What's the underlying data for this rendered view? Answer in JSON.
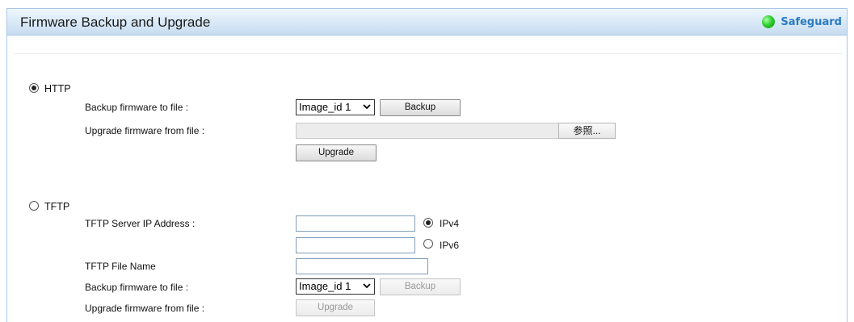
{
  "header": {
    "title": "Firmware Backup and Upgrade",
    "safeguard_label": "Safeguard"
  },
  "http": {
    "radio_label": "HTTP",
    "selected": true,
    "backup_label": "Backup firmware to file :",
    "backup_select_value": "Image_id 1",
    "backup_button": "Backup",
    "upgrade_label": "Upgrade firmware from file :",
    "browse_button": "参照...",
    "upgrade_button": "Upgrade"
  },
  "tftp": {
    "radio_label": "TFTP",
    "selected": false,
    "server_ip_label": "TFTP Server IP Address :",
    "ipv4_label": "IPv4",
    "ipv4_selected": true,
    "ipv6_label": "IPv6",
    "ipv6_selected": false,
    "ipv4_value": "",
    "ipv6_value": "",
    "file_name_label": "TFTP File Name",
    "file_name_value": "",
    "backup_label": "Backup firmware to file :",
    "backup_select_value": "Image_id 1",
    "backup_button": "Backup",
    "upgrade_label": "Upgrade firmware from file :",
    "upgrade_button": "Upgrade"
  },
  "colors": {
    "header_border": "#a9c6e6",
    "safeguard_text": "#2a79c2",
    "safeguard_dot": "#2fd02f"
  }
}
